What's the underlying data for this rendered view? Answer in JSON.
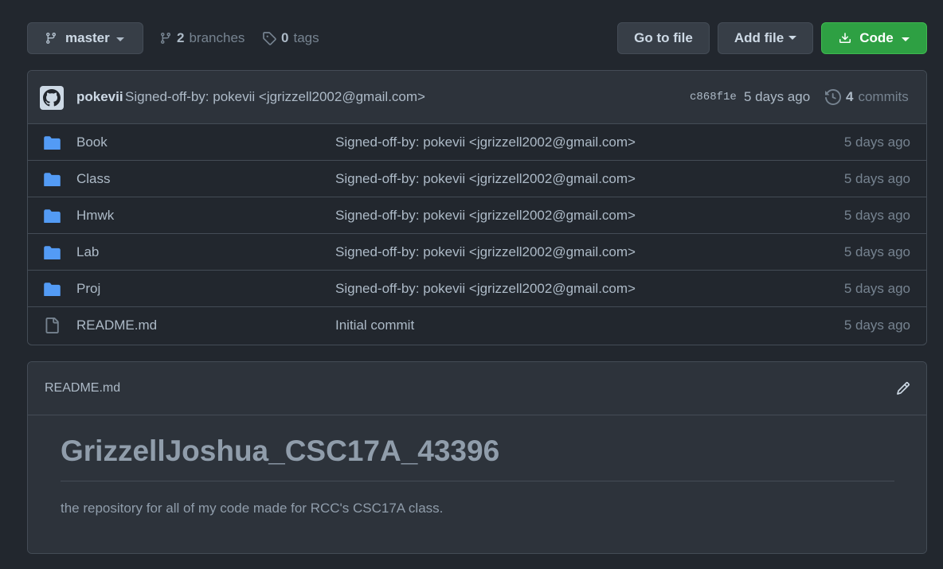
{
  "toolbar": {
    "branch": "master",
    "branches_count": "2",
    "branches_label": "branches",
    "tags_count": "0",
    "tags_label": "tags",
    "goto_file": "Go to file",
    "add_file": "Add file",
    "code": "Code"
  },
  "latest_commit": {
    "author": "pokevii",
    "message": "Signed-off-by: pokevii <jgrizzell2002@gmail.com>",
    "sha": "c868f1e",
    "age": "5 days ago",
    "commits_count": "4",
    "commits_label": "commits"
  },
  "files": [
    {
      "type": "dir",
      "name": "Book",
      "message": "Signed-off-by: pokevii <jgrizzell2002@gmail.com>",
      "age": "5 days ago"
    },
    {
      "type": "dir",
      "name": "Class",
      "message": "Signed-off-by: pokevii <jgrizzell2002@gmail.com>",
      "age": "5 days ago"
    },
    {
      "type": "dir",
      "name": "Hmwk",
      "message": "Signed-off-by: pokevii <jgrizzell2002@gmail.com>",
      "age": "5 days ago"
    },
    {
      "type": "dir",
      "name": "Lab",
      "message": "Signed-off-by: pokevii <jgrizzell2002@gmail.com>",
      "age": "5 days ago"
    },
    {
      "type": "dir",
      "name": "Proj",
      "message": "Signed-off-by: pokevii <jgrizzell2002@gmail.com>",
      "age": "5 days ago"
    },
    {
      "type": "file",
      "name": "README.md",
      "message": "Initial commit",
      "age": "5 days ago"
    }
  ],
  "readme": {
    "filename": "README.md",
    "heading": "GrizzellJoshua_CSC17A_43396",
    "paragraph": "the repository for all of my code made for RCC's CSC17A class."
  },
  "colors": {
    "background": "#22272e",
    "panel": "#2d333b",
    "border": "#444c56",
    "folder": "#539bf5",
    "code_button": "#2ea043"
  }
}
